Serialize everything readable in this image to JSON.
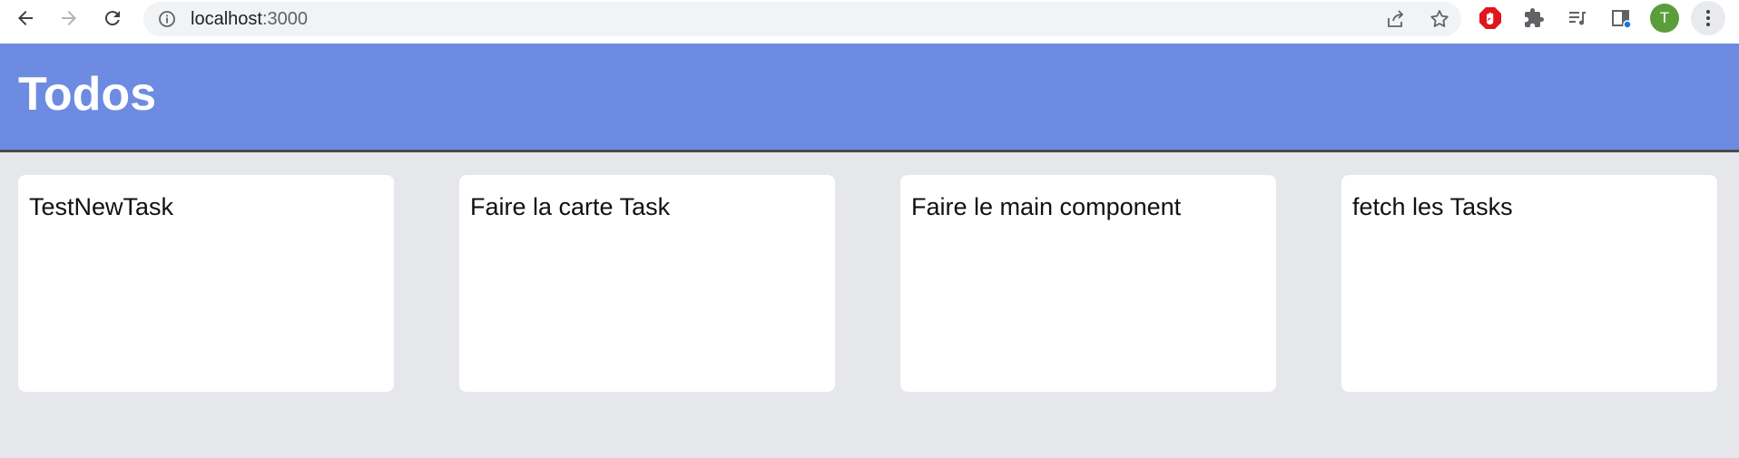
{
  "browser": {
    "url_host": "localhost",
    "url_port": ":3000",
    "avatar_letter": "T"
  },
  "app": {
    "title": "Todos"
  },
  "tasks": [
    {
      "title": "TestNewTask"
    },
    {
      "title": "Faire la carte Task"
    },
    {
      "title": "Faire le main component"
    },
    {
      "title": "fetch les Tasks"
    }
  ],
  "colors": {
    "header_bg": "#6d8ce1",
    "page_bg": "#e5e7eb",
    "card_bg": "#ffffff",
    "avatar_bg": "#5a9e3b",
    "extension_red": "#e0151e"
  },
  "icons": [
    "back-icon",
    "forward-icon",
    "reload-icon",
    "info-icon",
    "share-icon",
    "star-icon",
    "adblock-icon",
    "puzzle-icon",
    "media-queue-icon",
    "side-panel-icon",
    "kebab-menu-icon"
  ]
}
